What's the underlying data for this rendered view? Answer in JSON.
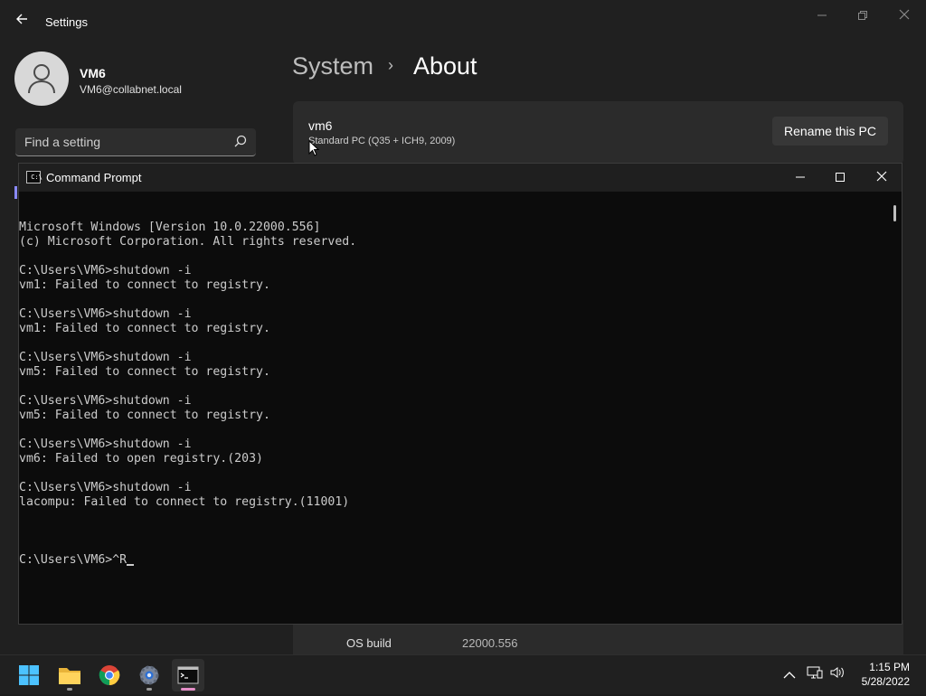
{
  "settings": {
    "app_title": "Settings",
    "user": {
      "name": "VM6",
      "email": "VM6@collabnet.local"
    },
    "search": {
      "placeholder": "Find a setting"
    },
    "breadcrumb": {
      "parent": "System",
      "separator": "›",
      "current": "About"
    },
    "pc": {
      "name": "vm6",
      "model": "Standard PC (Q35 + ICH9, 2009)",
      "rename_label": "Rename this PC"
    },
    "spec_row": {
      "label": "OS build",
      "value": "22000.556"
    }
  },
  "cmd": {
    "title": "Command Prompt",
    "lines": [
      "Microsoft Windows [Version 10.0.22000.556]",
      "(c) Microsoft Corporation. All rights reserved.",
      "",
      "C:\\Users\\VM6>shutdown -i",
      "vm1: Failed to connect to registry.",
      "",
      "C:\\Users\\VM6>shutdown -i",
      "vm1: Failed to connect to registry.",
      "",
      "C:\\Users\\VM6>shutdown -i",
      "vm5: Failed to connect to registry.",
      "",
      "C:\\Users\\VM6>shutdown -i",
      "vm5: Failed to connect to registry.",
      "",
      "C:\\Users\\VM6>shutdown -i",
      "vm6: Failed to open registry.(203)",
      "",
      "C:\\Users\\VM6>shutdown -i",
      "lacompu: Failed to connect to registry.(11001)",
      ""
    ],
    "prompt_line": "C:\\Users\\VM6>^R"
  },
  "taskbar": {
    "apps": [
      {
        "name": "start-button",
        "icon": "windows-logo-icon"
      },
      {
        "name": "file-explorer",
        "icon": "folder-icon"
      },
      {
        "name": "chrome",
        "icon": "chrome-icon"
      },
      {
        "name": "settings-app",
        "icon": "gear-icon"
      },
      {
        "name": "command-prompt",
        "icon": "terminal-icon"
      }
    ],
    "time": "1:15 PM",
    "date": "5/28/2022"
  },
  "colors": {
    "accent": "#0078d4",
    "cmd_bg": "#0c0c0c",
    "settings_bg": "#202020"
  }
}
